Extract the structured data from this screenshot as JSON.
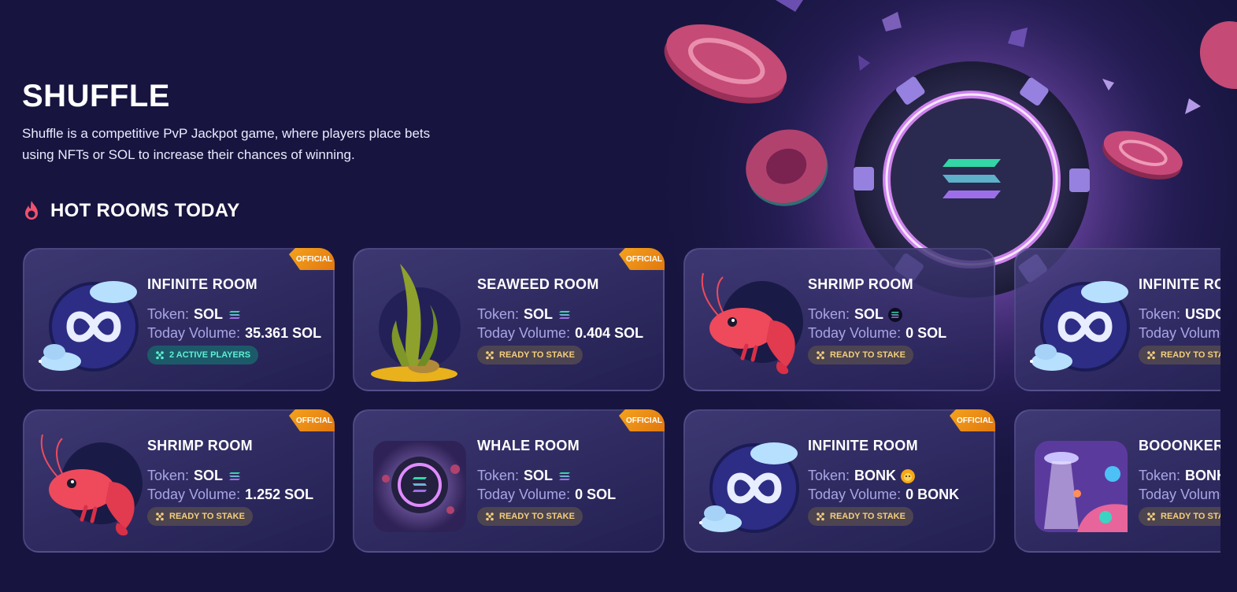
{
  "page": {
    "title": "SHUFFLE",
    "description_line1": "Shuffle is a competitive PvP Jackpot game, where players place bets",
    "description_line2": "using NFTs or SOL to increase their chances of winning."
  },
  "section": {
    "title": "HOT ROOMS TODAY",
    "icon": "fire-icon"
  },
  "labels": {
    "token": "Token:",
    "volume": "Today Volume:"
  },
  "colors": {
    "background": "#17153f",
    "card_label": "#a9a5e6",
    "official": "#f4a21d",
    "ready_text": "#f3cf7c",
    "active_text": "#5ff0d2",
    "fire": "#f0526d"
  },
  "rooms": [
    {
      "name": "INFINITE ROOM",
      "official": "OFFICIAL",
      "token": "SOL",
      "token_icon": "solana-icon",
      "volume": "35.361 SOL",
      "status": "2 ACTIVE PLAYERS",
      "status_type": "active",
      "image": "infinite-planet-icon"
    },
    {
      "name": "SEAWEED ROOM",
      "official": "OFFICIAL",
      "token": "SOL",
      "token_icon": "solana-icon",
      "volume": "0.404 SOL",
      "status": "READY TO STAKE",
      "status_type": "ready",
      "image": "seaweed-icon"
    },
    {
      "name": "SHRIMP ROOM",
      "official": "",
      "token": "SOL",
      "token_icon": "solana-dark-icon",
      "volume": "0 SOL",
      "status": "READY TO STAKE",
      "status_type": "ready",
      "image": "shrimp-icon"
    },
    {
      "name": "INFINITE ROO",
      "official": "",
      "token": "USDC",
      "token_icon": "",
      "volume": "",
      "status": "READY TO STAK",
      "status_type": "ready",
      "image": "infinite-planet-icon"
    },
    {
      "name": "SHRIMP ROOM",
      "official": "OFFICIAL",
      "token": "SOL",
      "token_icon": "solana-icon",
      "volume": "1.252 SOL",
      "status": "READY TO STAKE",
      "status_type": "ready",
      "image": "shrimp-icon"
    },
    {
      "name": "WHALE ROOM",
      "official": "OFFICIAL",
      "token": "SOL",
      "token_icon": "solana-icon",
      "volume": "0 SOL",
      "status": "READY TO STAKE",
      "status_type": "ready",
      "image": "casino-chip-space-icon"
    },
    {
      "name": "INFINITE ROOM",
      "official": "OFFICIAL",
      "token": "BONK",
      "token_icon": "bonk-icon",
      "volume": "0 BONK",
      "status": "READY TO STAKE",
      "status_type": "ready",
      "image": "infinite-planet-icon"
    },
    {
      "name": "BOOONKERS",
      "official": "",
      "token": "BONK",
      "token_icon": "",
      "volume": "",
      "status": "READY TO STAK",
      "status_type": "ready",
      "image": "space-ufo-icon"
    }
  ]
}
